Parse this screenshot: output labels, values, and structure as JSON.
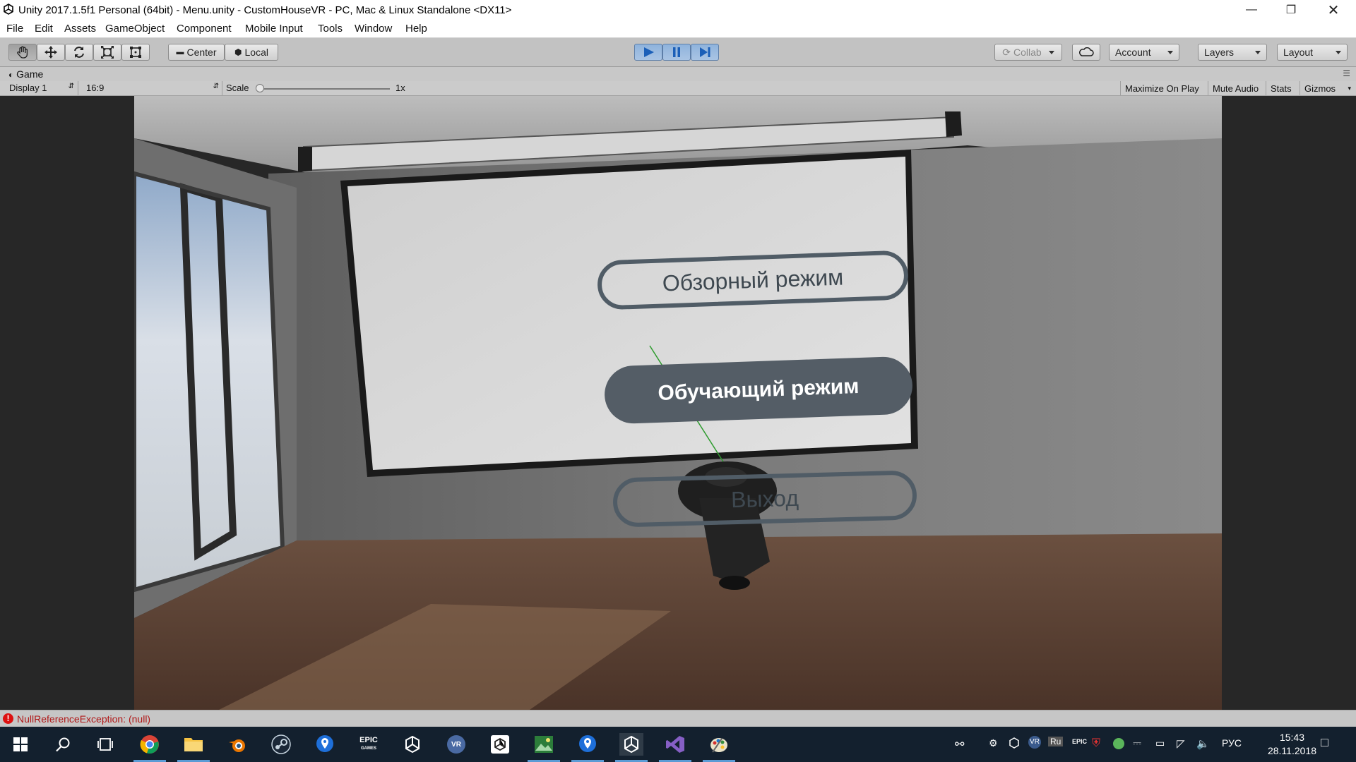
{
  "window": {
    "title": "Unity 2017.1.5f1 Personal (64bit) - Menu.unity - CustomHouseVR - PC, Mac & Linux Standalone <DX11>",
    "minimize_icon": "minimize-icon",
    "maximize_icon": "restore-icon",
    "close_icon": "close-icon"
  },
  "menubar": {
    "items": [
      "File",
      "Edit",
      "Assets",
      "GameObject",
      "Component",
      "Mobile Input",
      "Tools",
      "Window",
      "Help"
    ]
  },
  "toolbar": {
    "tools": [
      "hand-tool-icon",
      "move-tool-icon",
      "rotate-tool-icon",
      "scale-tool-icon",
      "rect-tool-icon"
    ],
    "pivot_label": "Center",
    "space_label": "Local",
    "play_icon": "play-icon",
    "pause_icon": "pause-icon",
    "step_icon": "step-icon",
    "collab_label": "Collab",
    "cloud_icon": "cloud-icon",
    "account_label": "Account",
    "layers_label": "Layers",
    "layout_label": "Layout"
  },
  "game_tab": {
    "label": "Game",
    "display": "Display 1",
    "aspect": "16:9",
    "scale_label": "Scale",
    "scale_value": "1x",
    "maximize_on_play": "Maximize On Play",
    "mute_audio": "Mute Audio",
    "stats": "Stats",
    "gizmos": "Gizmos"
  },
  "scene": {
    "menu_buttons": [
      "Обзорный режим",
      "Обучающий режим",
      "Выход"
    ],
    "selected_index": 1
  },
  "status": {
    "error_text": "NullReferenceException: (null)"
  },
  "taskbar": {
    "apps": [
      "start-icon",
      "search-icon",
      "task-view-icon",
      "chrome-icon",
      "file-explorer-icon",
      "blender-icon",
      "steam-icon",
      "maps-icon",
      "epic-games-icon",
      "unity-icon",
      "vr-icon",
      "unity-hub-icon",
      "image-editor-icon",
      "maps-icon-2",
      "unity-editor-icon",
      "visual-studio-icon",
      "paint-icon"
    ],
    "lang": "РУС",
    "keyboard": "Ru",
    "time": "15:43",
    "date": "28.11.2018"
  }
}
